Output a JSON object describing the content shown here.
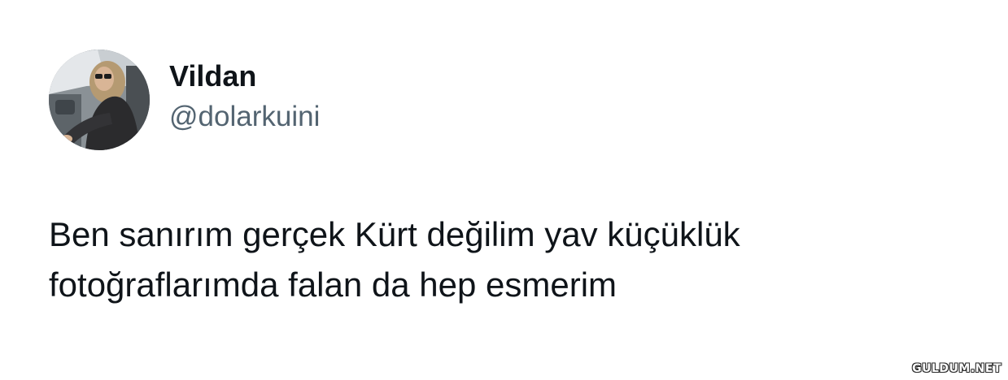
{
  "tweet": {
    "author": {
      "display_name": "Vildan",
      "handle": "@dolarkuini",
      "avatar": "profile-photo"
    },
    "text": "Ben sanırım gerçek Kürt değilim yav küçüklük\nfotoğraflarımda falan da hep esmerim"
  },
  "watermark": {
    "text": "GULDUM.NET"
  }
}
